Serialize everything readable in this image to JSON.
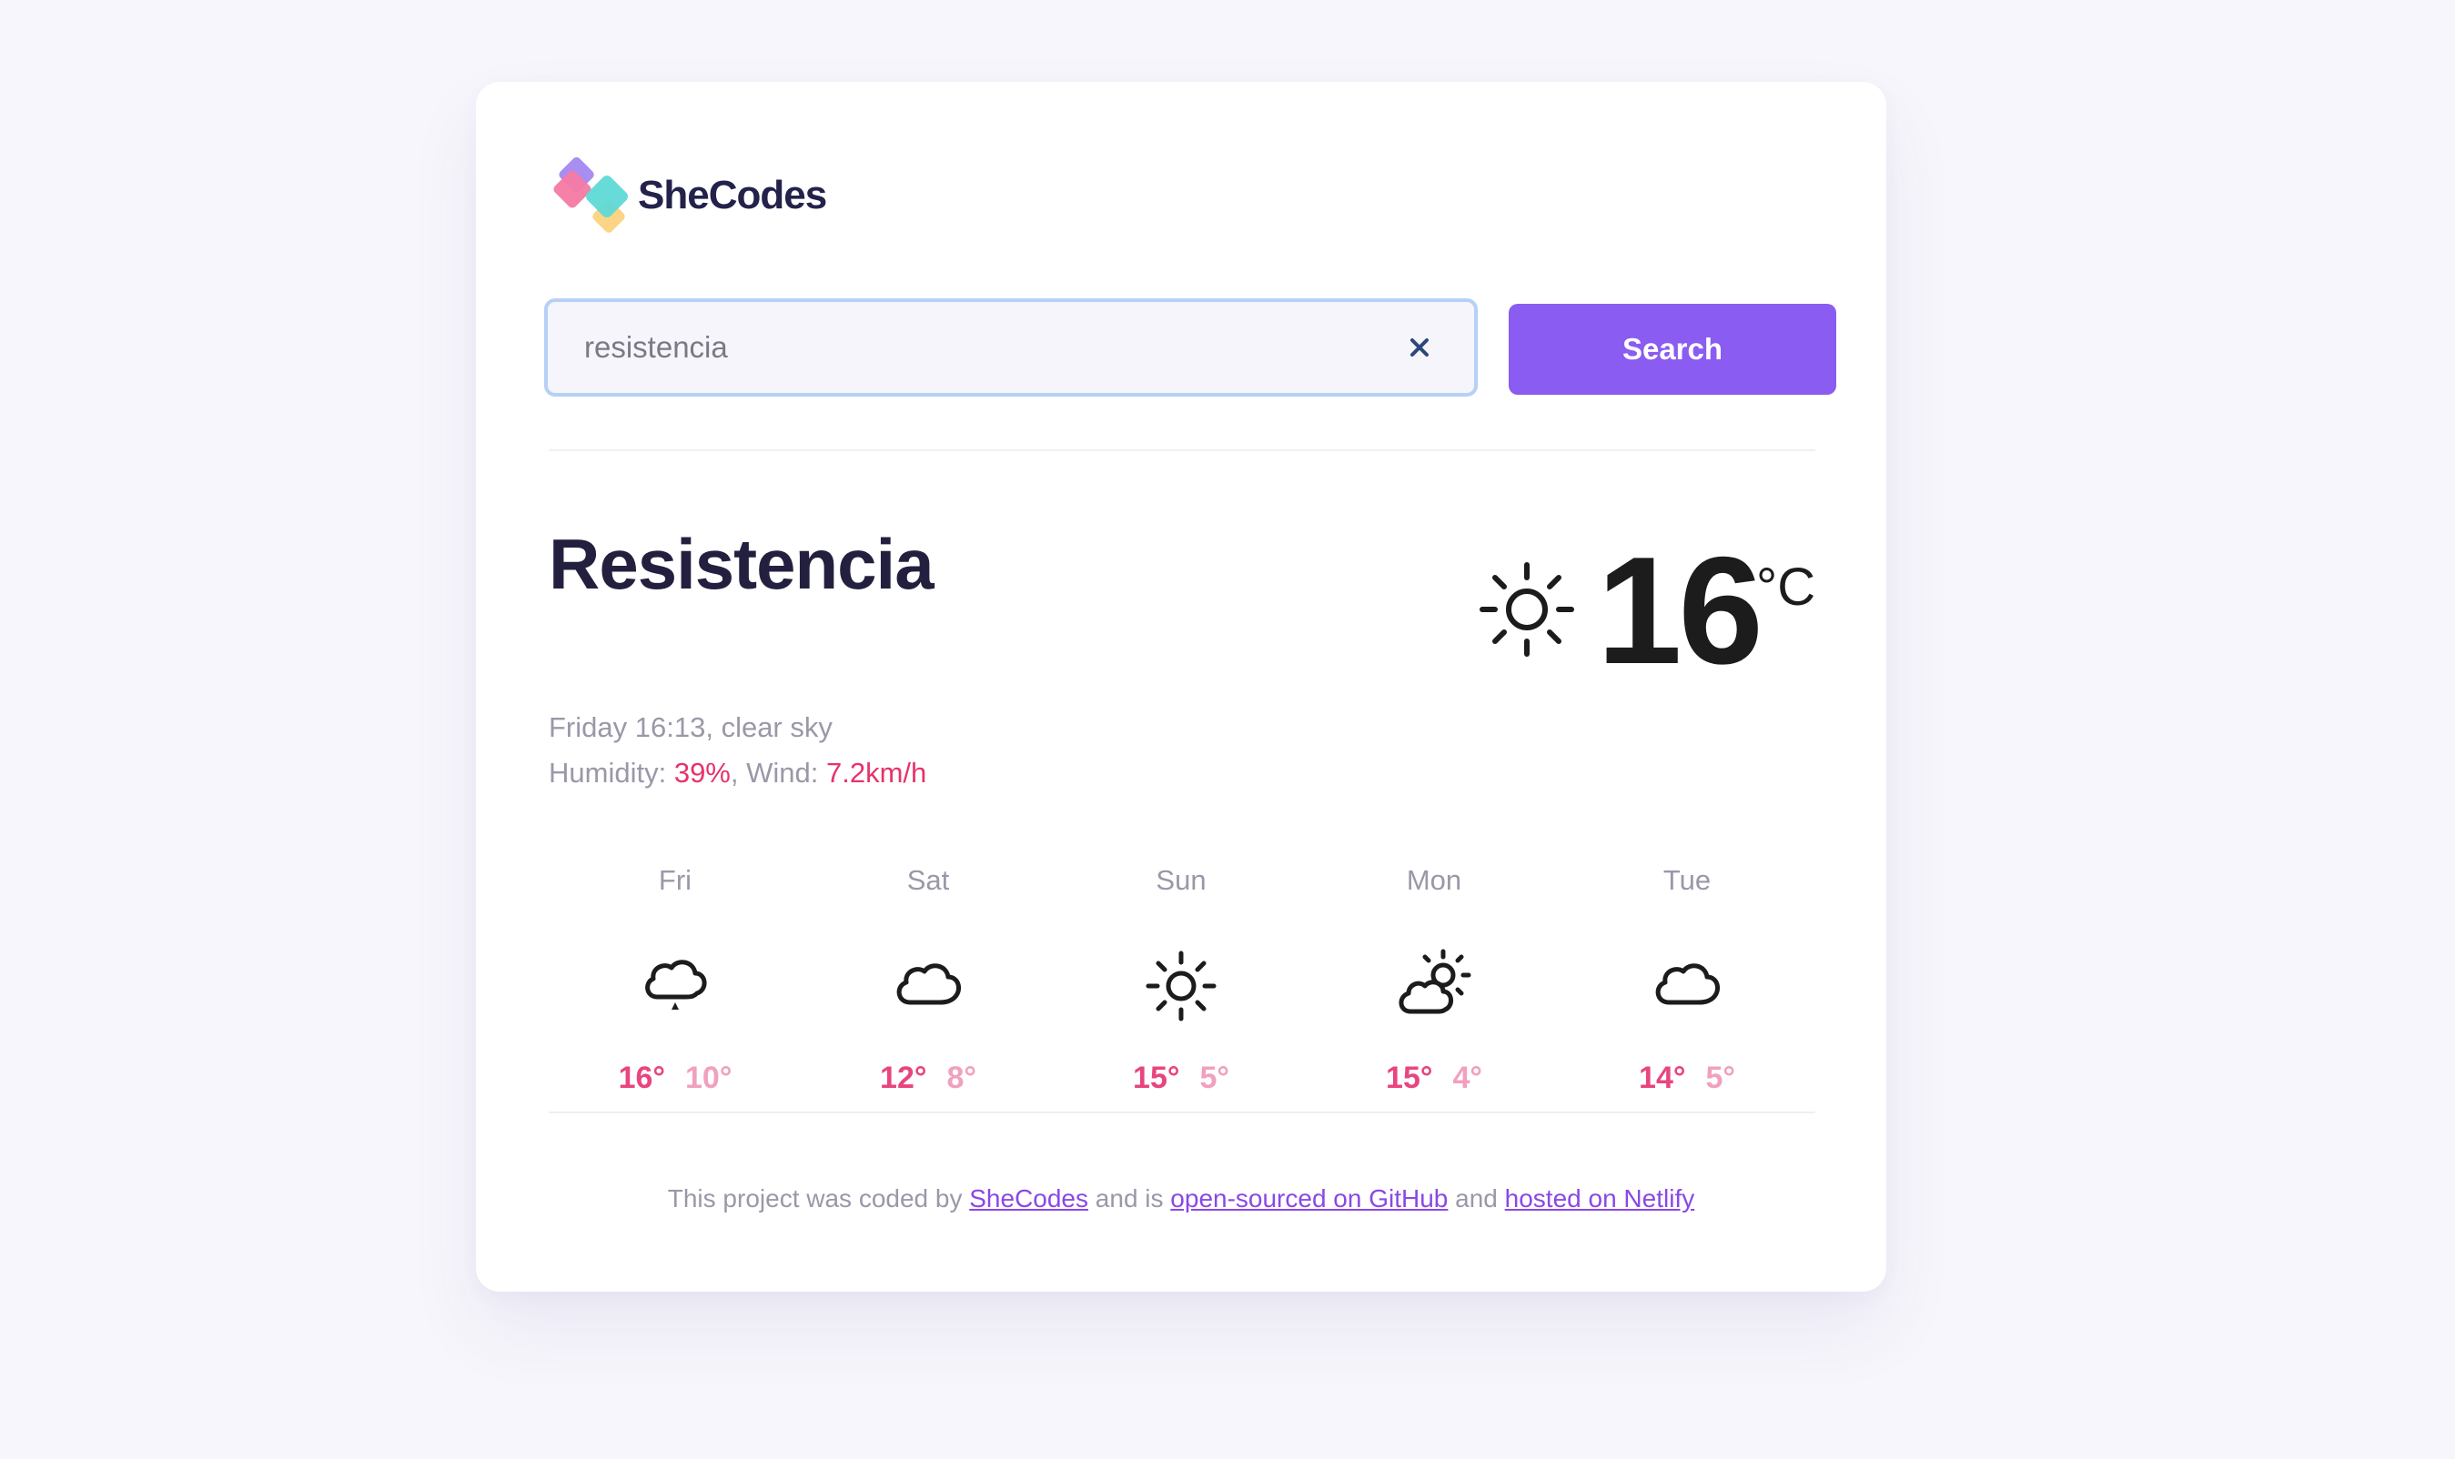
{
  "brand": {
    "name": "SheCodes"
  },
  "search": {
    "value": "resistencia",
    "placeholder": "",
    "button_label": "Search"
  },
  "current": {
    "city": "Resistencia",
    "day_time": "Friday 16:13",
    "description": "clear sky",
    "humidity_label": "Humidity:",
    "humidity_value": "39%",
    "wind_label": "Wind:",
    "wind_value": "7.2km/h",
    "temperature": "16",
    "unit": "°C",
    "icon": "sun-icon"
  },
  "forecast": [
    {
      "day": "Fri",
      "icon": "rain-cloud-icon",
      "max": "16°",
      "min": "10°"
    },
    {
      "day": "Sat",
      "icon": "cloud-icon",
      "max": "12°",
      "min": "8°"
    },
    {
      "day": "Sun",
      "icon": "sun-icon",
      "max": "15°",
      "min": "5°"
    },
    {
      "day": "Mon",
      "icon": "partly-cloudy-icon",
      "max": "15°",
      "min": "4°"
    },
    {
      "day": "Tue",
      "icon": "cloud-icon",
      "max": "14°",
      "min": "5°"
    }
  ],
  "footer": {
    "text_1": "This project was coded by",
    "link_1": "SheCodes",
    "text_2": "and is",
    "link_2": "open-sourced on GitHub",
    "text_3": "and",
    "link_3": "hosted on Netlify"
  },
  "colors": {
    "accent": "#8a5cf2",
    "highlight": "#e6336b",
    "temp_max": "#e84580",
    "temp_min": "#f1a0bf"
  }
}
